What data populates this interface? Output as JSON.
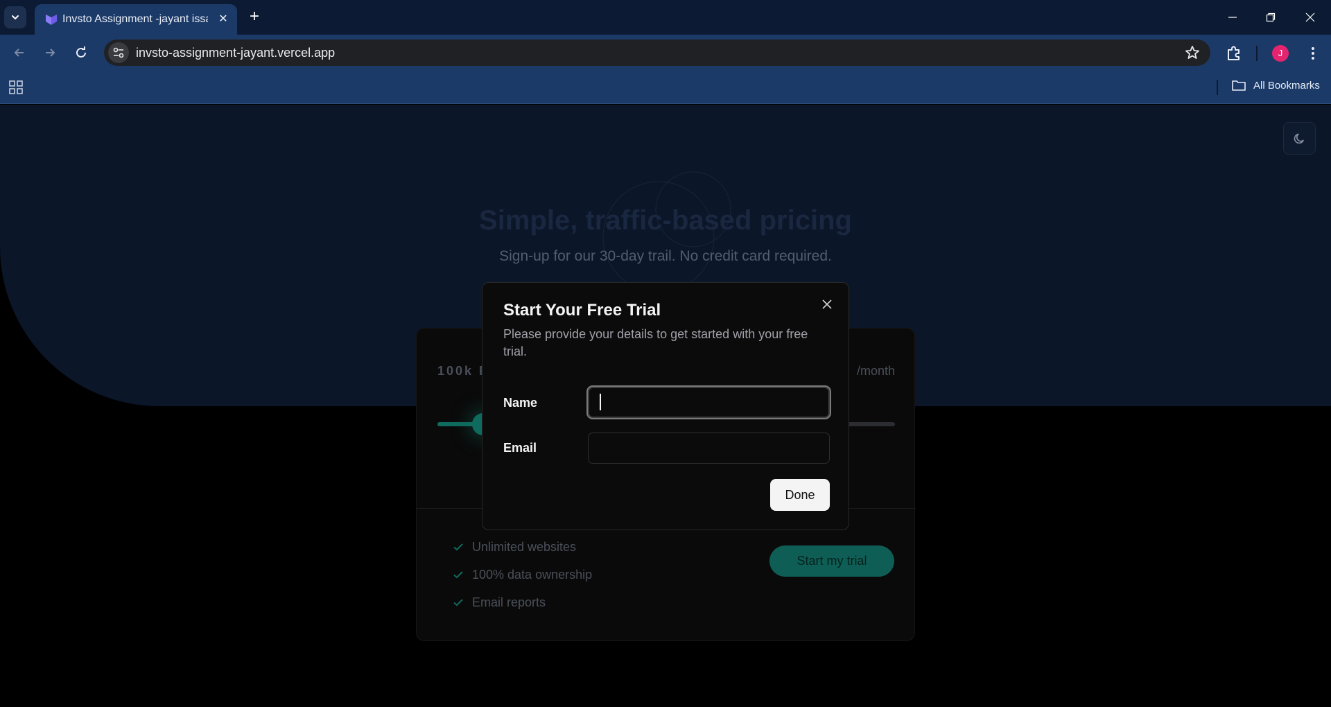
{
  "browser": {
    "tab_title": "Invsto Assignment -jayant issar",
    "url": "invsto-assignment-jayant.vercel.app",
    "avatar_letter": "J",
    "all_bookmarks_label": "All Bookmarks"
  },
  "hero": {
    "title": "Simple, traffic-based pricing",
    "subtitle": "Sign-up for our 30-day trail. No credit card required."
  },
  "pricing_card": {
    "pageviews_label": "100k P",
    "price_unit": "/month",
    "slider_value_fraction": 0.1,
    "features": [
      "Unlimited websites",
      "100% data ownership",
      "Email reports"
    ],
    "cta_label": "Start my trial"
  },
  "modal": {
    "title": "Start Your Free Trial",
    "description": "Please provide your details to get started with your free trial.",
    "name_label": "Name",
    "name_value": "",
    "email_label": "Email",
    "email_value": "",
    "done_label": "Done"
  },
  "colors": {
    "accent": "#0f6b5d",
    "browser_frame": "#1c3a68",
    "avatar": "#e5246f"
  }
}
